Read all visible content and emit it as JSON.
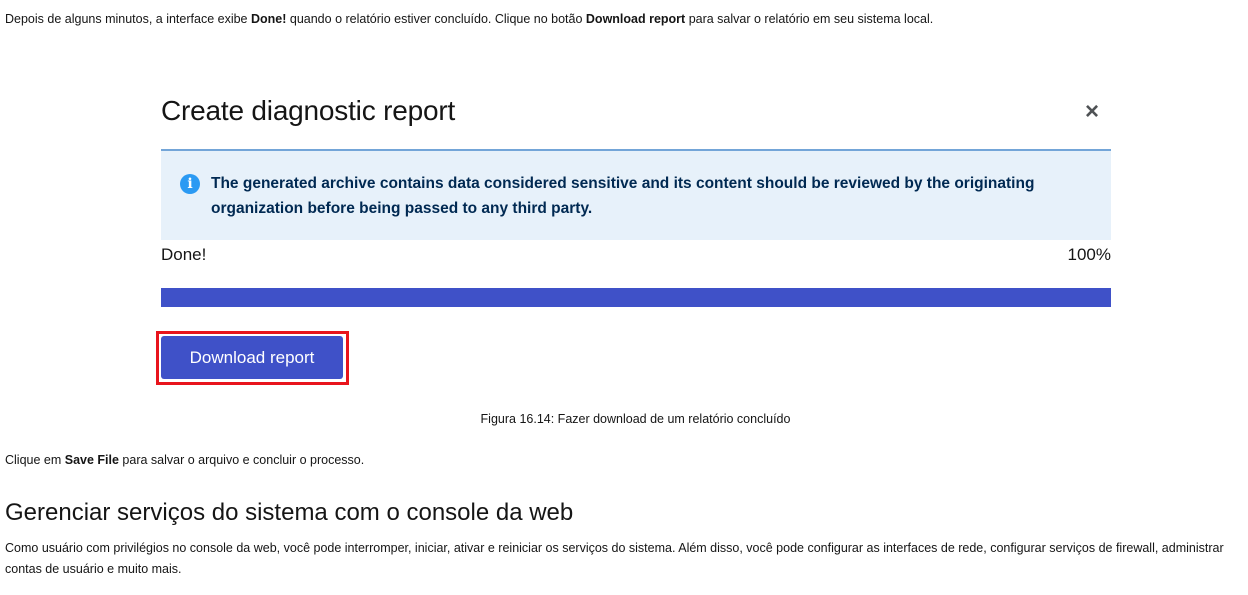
{
  "intro": {
    "text_1": "Depois de alguns minutos, a interface exibe ",
    "bold_1": "Done!",
    "text_2": " quando o relatório estiver concluído. Clique no botão ",
    "bold_2": "Download report",
    "text_3": " para salvar o relatório em seu sistema local."
  },
  "figure": {
    "modal_title": "Create diagnostic report",
    "close_icon": "close-icon",
    "close_glyph": "×",
    "alert": {
      "icon": "info-icon",
      "icon_glyph": "i",
      "text": "The generated archive contains data considered sensitive and its content should be reviewed by the originating organization before being passed to any third party."
    },
    "progress": {
      "label": "Done!",
      "value_text": "100%",
      "percent": 100
    },
    "download_button_label": "Download report",
    "caption": "Figura 16.14: Fazer download de um relatório concluído"
  },
  "after_figure": {
    "text_1": "Clique em ",
    "bold_1": "Save File",
    "text_2": " para salvar o arquivo e concluir o processo."
  },
  "section": {
    "heading": "Gerenciar serviços do sistema com o console da web",
    "body": "Como usuário com privilégios no console da web, você pode interromper, iniciar, ativar e reiniciar os serviços do sistema. Além disso, você pode configurar as interfaces de rede, configurar serviços de firewall, administrar contas de usuário e muito mais."
  },
  "colors": {
    "primary_blue": "#3f51c8",
    "alert_background": "#e7f1fa",
    "alert_text": "#002952",
    "info_icon": "#2b9af3",
    "highlight_red": "#e8141c"
  }
}
